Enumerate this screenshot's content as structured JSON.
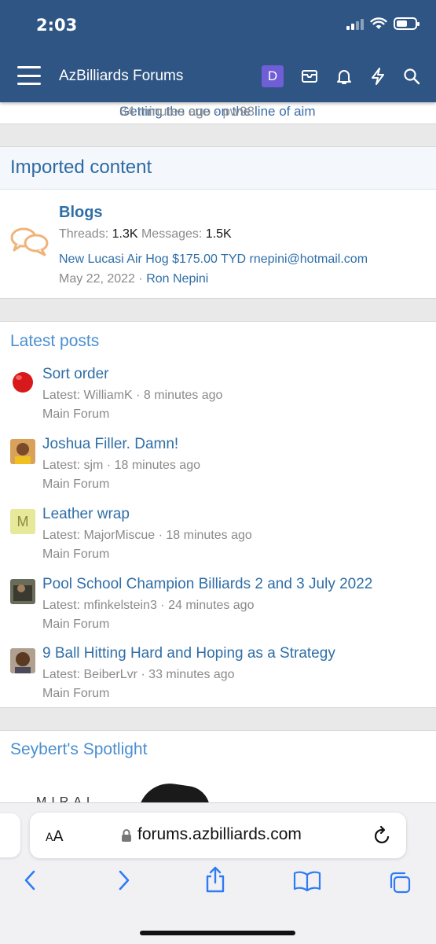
{
  "status_bar": {
    "time": "2:03"
  },
  "header": {
    "site_title": "AzBilliards Forums",
    "avatar_letter": "D"
  },
  "peek_row": {
    "title": "Getting the cue on the line of aim",
    "meta": "34 minutes ago · pw98"
  },
  "imported": {
    "section_title": "Imported content",
    "forum": {
      "title": "Blogs",
      "threads_label": "Threads:",
      "threads_value": "1.3K",
      "messages_label": "Messages:",
      "messages_value": "1.5K",
      "last_post_title": "New Lucasi Air Hog $175.00 TYD rnepini@hotmail.com",
      "last_post_date": "May 22, 2022",
      "last_post_sep": "·",
      "last_post_user": "Ron Nepini"
    }
  },
  "latest_posts": {
    "title": "Latest posts",
    "items": [
      {
        "title": "Sort order",
        "meta": "Latest: WilliamK · 8 minutes ago",
        "forum": "Main Forum",
        "avatar": "red-ball"
      },
      {
        "title": "Joshua Filler. Damn!",
        "meta": "Latest: sjm · 18 minutes ago",
        "forum": "Main Forum",
        "avatar": "photo"
      },
      {
        "title": "Leather wrap",
        "meta": "Latest: MajorMiscue · 18 minutes ago",
        "forum": "Main Forum",
        "avatar": "M"
      },
      {
        "title": "Pool School Champion Billiards 2 and 3 July 2022",
        "meta": "Latest: mfinkelstein3 · 24 minutes ago",
        "forum": "Main Forum",
        "avatar": "photo"
      },
      {
        "title": "9 Ball Hitting Hard and Hoping as a Strategy",
        "meta": "Latest: BeiberLvr · 33 minutes ago",
        "forum": "Main Forum",
        "avatar": "photo"
      }
    ]
  },
  "spotlight": {
    "title": "Seybert's Spotlight",
    "image_text": "MIRAL"
  },
  "safari": {
    "aa_big": "A",
    "aa_small": "A",
    "url": "forums.azbilliards.com"
  },
  "colors": {
    "header_bg": "#2f5584",
    "link": "#2f6ea7",
    "section_title": "#4a90d0",
    "avatar_d": "#6f5ed6"
  }
}
